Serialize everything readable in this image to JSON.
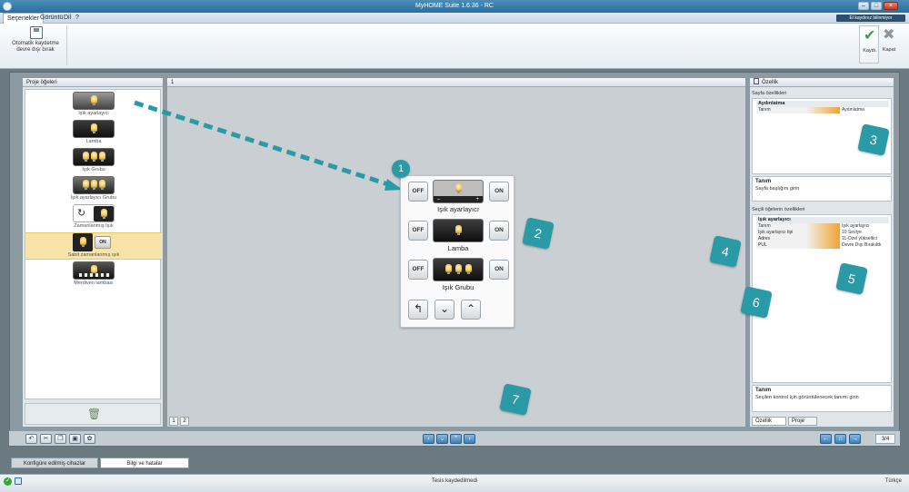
{
  "window": {
    "title": "MyHOME Suite 1.6.36 - RC"
  },
  "menu": {
    "items": [
      "Seçenekler",
      "Görüntü",
      "Dil",
      "?"
    ],
    "legend_button": "El kaydınız bilinmiyor"
  },
  "ribbon": {
    "autosave_label": "Otomatik kaydetme\ndevre dışı bırak",
    "save_label": "Kaydı.",
    "close_label": "Kapat"
  },
  "left_panel": {
    "title": "Proje öğeleri",
    "items": [
      {
        "label": "Işık ayarlayıcı"
      },
      {
        "label": "Lamba"
      },
      {
        "label": "Işık Grubu"
      },
      {
        "label": "Işık ayarlayıcı Grubu"
      },
      {
        "label": "Zamanlanmış Işık"
      },
      {
        "label": "Sabit zamanlanmış ışık",
        "selected": true
      },
      {
        "label": "Merdiven lambası"
      }
    ]
  },
  "center_panel": {
    "header": "1",
    "page_tabs": [
      "1",
      "2"
    ],
    "card": {
      "rows": [
        {
          "off": "OFF",
          "on": "ON",
          "label": "Işık ayarlayıcı"
        },
        {
          "off": "OFF",
          "on": "ON",
          "label": "Lamba"
        },
        {
          "off": "OFF",
          "on": "ON",
          "label": "Işık Grubu"
        }
      ]
    }
  },
  "right_panel": {
    "title": "Özellik",
    "page_props_title": "Sayfa özellikleri",
    "page_group": "Aydınlatma",
    "page_props": [
      {
        "key": "Tanım",
        "value": "Aydınlatma"
      }
    ],
    "tanim1": {
      "title": "Tanım",
      "desc": "Sayfa başlığını girin"
    },
    "selected_props_title": "Seçili öğelerin özellikleri",
    "selected_group": "Işık ayarlayıcı",
    "selected_props": [
      {
        "key": "Tanım",
        "value": "Işık ayarlayıcı"
      },
      {
        "key": "Işık ayarlayıcı tipi",
        "value": "10 Seviye"
      },
      {
        "key": "Adres",
        "value": "11-Özel yükseltici"
      },
      {
        "key": "PUL",
        "value": "Devre Dışı Bırakıldı"
      }
    ],
    "tanim2": {
      "title": "Tanım",
      "desc": "Seçilen kontrol için görüntülenecek tanımı girin"
    },
    "tabs": [
      "Özellik",
      "Proje"
    ]
  },
  "toolbar": {
    "page_indicator": "3/4"
  },
  "bottom_tabs": [
    "Konfigüre edilmiş cihazlar",
    "Bilgi ve hatalar"
  ],
  "status": {
    "text": "Tesis kaydedilmedi",
    "language": "Türkçe"
  },
  "annotations": [
    "1",
    "2",
    "3",
    "4",
    "5",
    "6",
    "7"
  ],
  "colors": {
    "accent_orange": "#f2a233",
    "callout_teal": "#2a9aa6",
    "selected_row": "#f8e3a8"
  }
}
